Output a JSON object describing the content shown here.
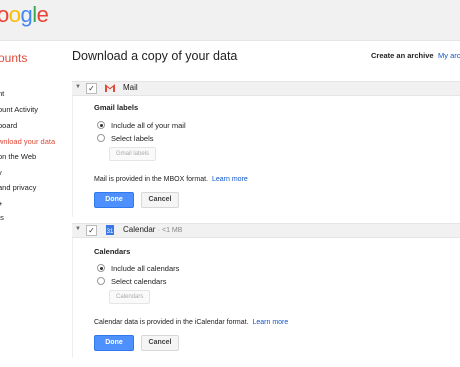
{
  "header": {
    "logo_parts": [
      "o",
      "o",
      "g",
      "l",
      "e"
    ],
    "colors": {
      "brand_red": "#dd4b39",
      "link_blue": "#1155cc",
      "primary_blue": "#4d90fe"
    }
  },
  "sidebar": {
    "title": "ounts",
    "items": [
      {
        "label": "nt"
      },
      {
        "label": "ount Activity"
      },
      {
        "label": "board"
      },
      {
        "label": "wnload your data",
        "active": true
      },
      {
        "label": "on the Web"
      },
      {
        "label": "y"
      },
      {
        "label": "and privacy"
      },
      {
        "label": "+"
      },
      {
        "label": "ts"
      }
    ]
  },
  "main": {
    "title": "Download a copy of your data",
    "create_archive": "Create an archive",
    "my_archives": "My arc"
  },
  "mail": {
    "name": "Mail",
    "checked": "✓",
    "subheading": "Gmail labels",
    "option_all": "Include all of your mail",
    "option_select": "Select labels",
    "labels_button": "Gmail labels",
    "info": "Mail is provided in the MBOX format.",
    "learn_more": "Learn more",
    "done": "Done",
    "cancel": "Cancel"
  },
  "calendar": {
    "name": "Calendar",
    "size": "· <1 MB",
    "checked": "✓",
    "icon_text": "31",
    "subheading": "Calendars",
    "option_all": "Include all calendars",
    "option_select": "Select calendars",
    "calendars_button": "Calendars",
    "info": "Calendar data is provided in the iCalendar format.",
    "learn_more": "Learn more",
    "done": "Done",
    "cancel": "Cancel"
  }
}
